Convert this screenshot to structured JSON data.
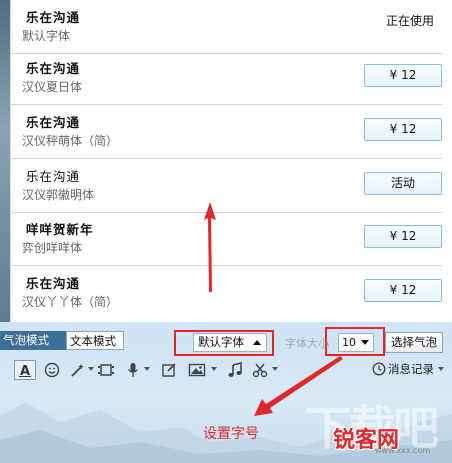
{
  "font_list": [
    {
      "title": "乐在沟通",
      "subtitle": "默认字体",
      "status": "正在使用"
    },
    {
      "title": "乐在沟通",
      "subtitle": "汉仪夏日体",
      "price": "¥ 12"
    },
    {
      "title": "乐在沟通",
      "subtitle": "汉仪秤萌体（简）",
      "price": "¥ 12"
    },
    {
      "title": "乐在沟通",
      "subtitle": "汉仪郭徽明体",
      "action": "活动"
    },
    {
      "title": "咩咩贺新年",
      "subtitle": "弈创咩咩体",
      "price": "¥ 12"
    },
    {
      "title": "乐在沟通",
      "subtitle": "汉仪丫丫体（简）",
      "price": "¥ 12"
    }
  ],
  "toolbar": {
    "tab_bubble": "气泡模式",
    "tab_text": "文本模式",
    "font_select": "默认字体",
    "size_label": "字体大小",
    "size_select": "10",
    "choose_bubble": "选择气泡",
    "message_record": "消息记录"
  },
  "annotation": {
    "caption": "设置字号",
    "color": "#e0282b"
  },
  "watermark": {
    "big": "下载吧",
    "brand": "锐客网",
    "url": "www.xxx.com"
  },
  "icons": [
    "font-icon",
    "emoji-icon",
    "magic-icon",
    "video-icon",
    "mic-icon",
    "screenshot-icon",
    "image-icon",
    "music-icon",
    "scissors-icon",
    "clock-icon"
  ]
}
